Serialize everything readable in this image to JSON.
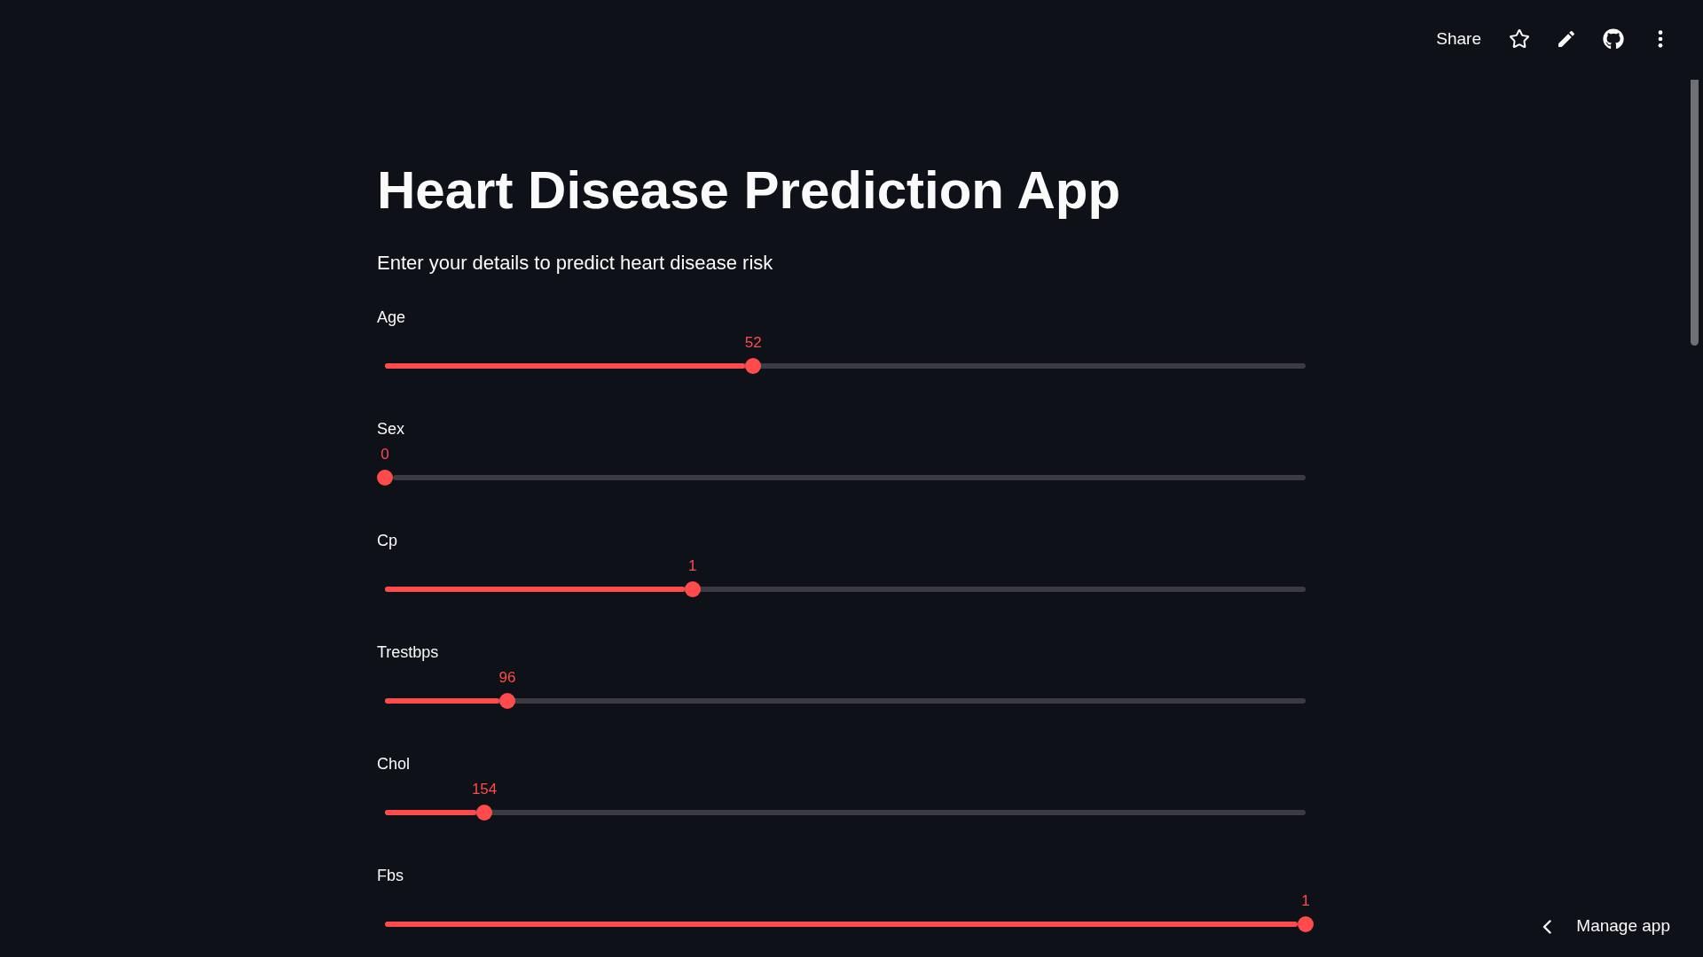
{
  "toolbar": {
    "share_label": "Share"
  },
  "title": "Heart Disease Prediction App",
  "subtitle": "Enter your details to predict heart disease risk",
  "sliders": [
    {
      "label": "Age",
      "value": "52",
      "level": 0.4
    },
    {
      "label": "Sex",
      "value": "0",
      "level": 0
    },
    {
      "label": "Cp",
      "value": "1",
      "level": 0.334
    },
    {
      "label": "Trestbps",
      "value": "96",
      "level": 0.133
    },
    {
      "label": "Chol",
      "value": "154",
      "level": 0.108
    },
    {
      "label": "Fbs",
      "value": "1",
      "level": 1
    }
  ],
  "manage_app": {
    "label": "Manage app"
  }
}
